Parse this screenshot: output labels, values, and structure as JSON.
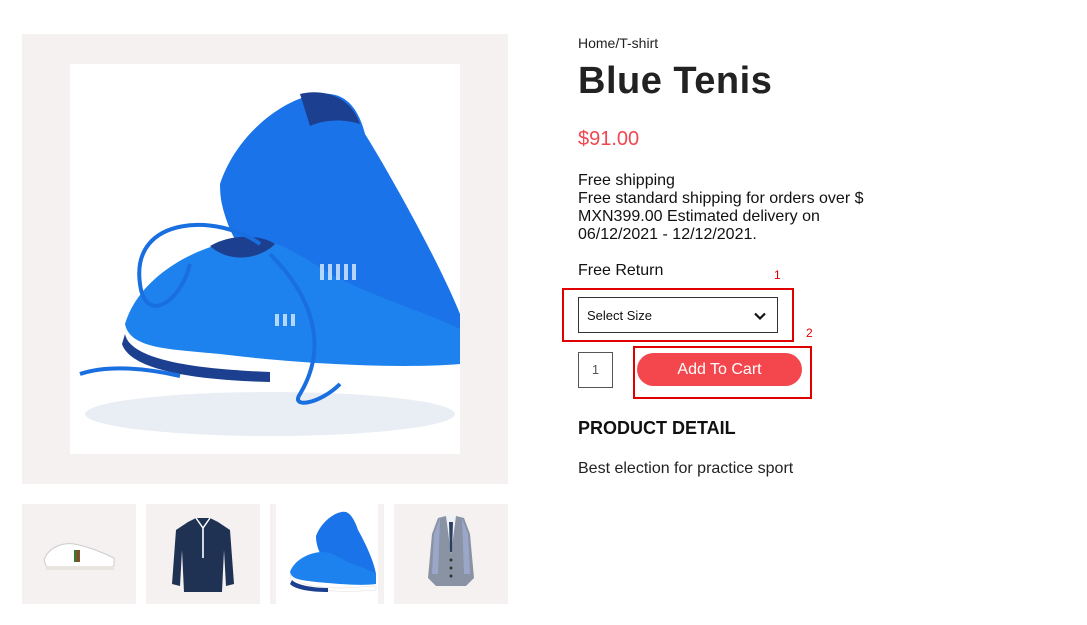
{
  "breadcrumb": "Home/T-shirt",
  "product": {
    "title": "Blue Tenis",
    "price": "$91.00",
    "shipping_title": "Free shipping",
    "shipping_text": "Free standard shipping for orders over $ MXN399.00 Estimated delivery on 06/12/2021 - 12/12/2021.",
    "return_text": "Free Return",
    "size_select_label": "Select Size",
    "quantity": "1",
    "add_to_cart_label": "Add To Cart",
    "detail_heading": "PRODUCT DETAIL",
    "detail_text": "Best election for practice sport"
  },
  "annotations": {
    "marker_1": "1",
    "marker_2": "2"
  },
  "thumbnails": [
    {
      "icon": "sneaker-white-icon"
    },
    {
      "icon": "navy-shirt-icon"
    },
    {
      "icon": "blue-sneakers-icon"
    },
    {
      "icon": "grey-vest-icon"
    }
  ],
  "colors": {
    "price": "#f0474f",
    "button": "#f4474d",
    "annotation": "#e10000",
    "image_background": "#f4f1f0"
  }
}
